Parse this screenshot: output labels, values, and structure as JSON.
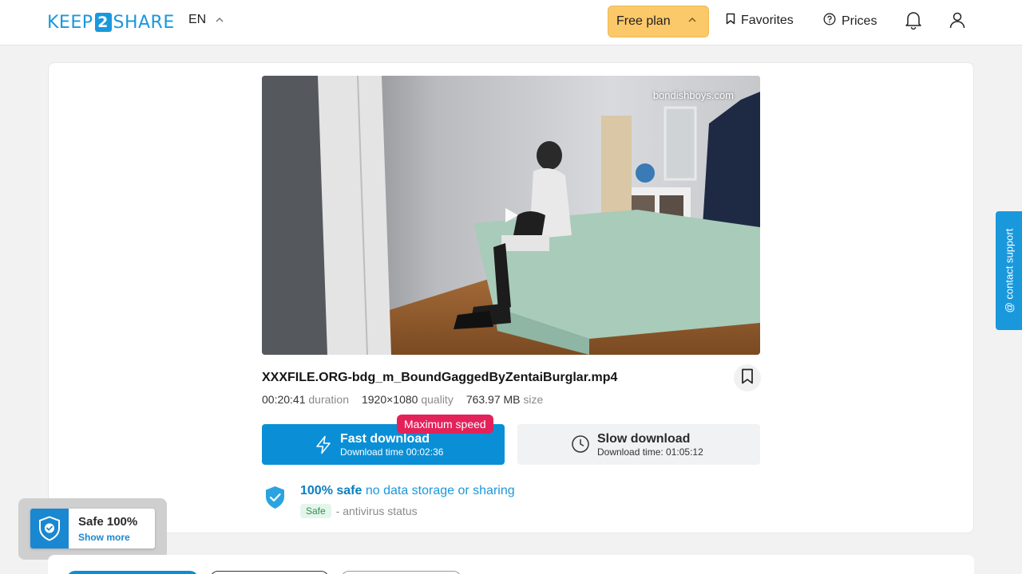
{
  "header": {
    "logo_left": "KEEP",
    "logo_num": "2",
    "logo_right": "SHARE",
    "lang": "EN",
    "plan_label": "Free plan",
    "favorites_label": "Favorites",
    "prices_label": "Prices"
  },
  "video": {
    "watermark": "bondishboys.com"
  },
  "file": {
    "name": "XXXFILE.ORG-bdg_m_BoundGaggedByZentaiBurglar.mp4",
    "duration": "00:20:41",
    "duration_label": "duration",
    "quality": "1920×1080",
    "quality_label": "quality",
    "size": "763.97 MB",
    "size_label": "size"
  },
  "download": {
    "badge": "Maximum speed",
    "fast_title": "Fast download",
    "fast_sub": "Download time 00:02:36",
    "slow_title": "Slow download",
    "slow_sub": "Download time: 01:05:12"
  },
  "safety": {
    "strong": "100% safe",
    "rest": "no data storage or sharing",
    "badge": "Safe",
    "status": "- antivirus status"
  },
  "widget": {
    "title": "Safe 100%",
    "link": "Show more"
  },
  "support": {
    "label": "@ contact support"
  },
  "colors": {
    "accent": "#0a8fd6",
    "plan": "#fbc86a",
    "badge": "#e3225a"
  }
}
